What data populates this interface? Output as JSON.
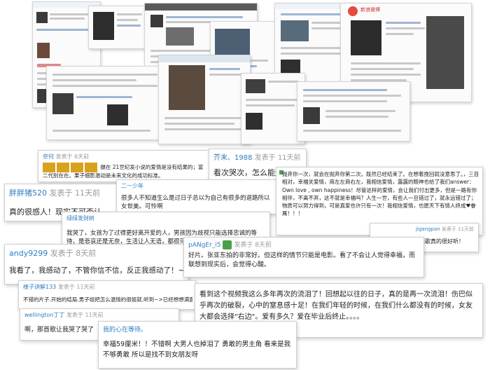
{
  "cards": {
    "c1": {
      "name": "奈何",
      "time": "发表于 6天前",
      "text": "摄在 21世纪发小说的爱情是没有结果的；富二代别在在。果子细影激动是未来文化的成功标准。"
    },
    "c2": {
      "name": "芥末、1988",
      "time": "发表于 11天前",
      "text": "看次哭次，怎么能这样呢。"
    },
    "c3": {
      "name": "胖胖猪520",
      "time": "发表于 11天前",
      "text": "真的很感人！现实不可否认"
    },
    "c4": {
      "name": "二一少年",
      "text": "很多人不知道生么是过日子总以为自己有很多的退路所以女世美。可怜啊"
    },
    "c5": {
      "text": "抛弃你一次，就会在抛弃你第二次。既然已经结束了。在想着挽回就没意思了。，三目相对，幸福关爱情，商左左商右左，我相信爱情，露露的眼神也给了我们answer：Own love , own happiness！尽管这样的爱情，会让我们付出更多，但是一路有你相伴，不离不弃，这不就是幸福吗？人生一世，有些人一旦错过了，就永远错过了；物质可以努力得到，可是真爱也许只有一次！我相信爱情，也愿天下有情人终成♥眷属！！！"
    },
    "c6": {
      "name": "绿绿发财树",
      "text": "我哭了，女孩为了过得更好离开爱的人，男孩因为歧视只能选择忠诚的等待，是悲哀还是无奈，生活让人无语，都很可怜。"
    },
    "c7": {
      "name": "jigangpan",
      "time": "发表于 11天前",
      "text": "真多很感人啊！那爸歌真的很好听！"
    },
    "c8": {
      "name": "andy9299",
      "time": "发表于 8天前",
      "text": "我看了，我感动了，不管你信不信，反正我感动了！~"
    },
    "c9": {
      "name": "pANgEr_i5",
      "time": "发表于 8天前",
      "text": "好片。张亚东拍的非常好。但这样的情节只能是电影。看了不会让人觉得幸福，而联想到现实后，会觉得心酸。"
    },
    "c10": {
      "name": "楼子讲解133",
      "time": "发表于 11天前",
      "text": "不错的片子.开始的结局.男子组把怎么温情的很姐就.听到~>已经想想满面了"
    },
    "c11": {
      "text": "看到这个视频我这么多年再次的流泪了！回想起以往的日子，真的是再一次流泪！伤巴似乎再次的破裂，心中的窒息感十足！在我们年轻的时候，在我们什么都没有的时候，女友大都会选择\"右边\"。爱有多久？爱在毕业后终止。。。。"
    },
    "c12": {
      "name": "wellington丁丁",
      "time": "发表于 11天前",
      "text": "啊，那首歌让我哭了哭了"
    },
    "c13": {
      "name": "我的心在等待。",
      "text": "幸福59厘米！！不错啊 大男人也掉泪了 勇敢的男主角 看来是我不够勇敢 所以是找不到女朋友呀"
    }
  },
  "colors": {
    "link": "#2f7ec0",
    "text": "#222222",
    "time": "#9a9a9a"
  }
}
